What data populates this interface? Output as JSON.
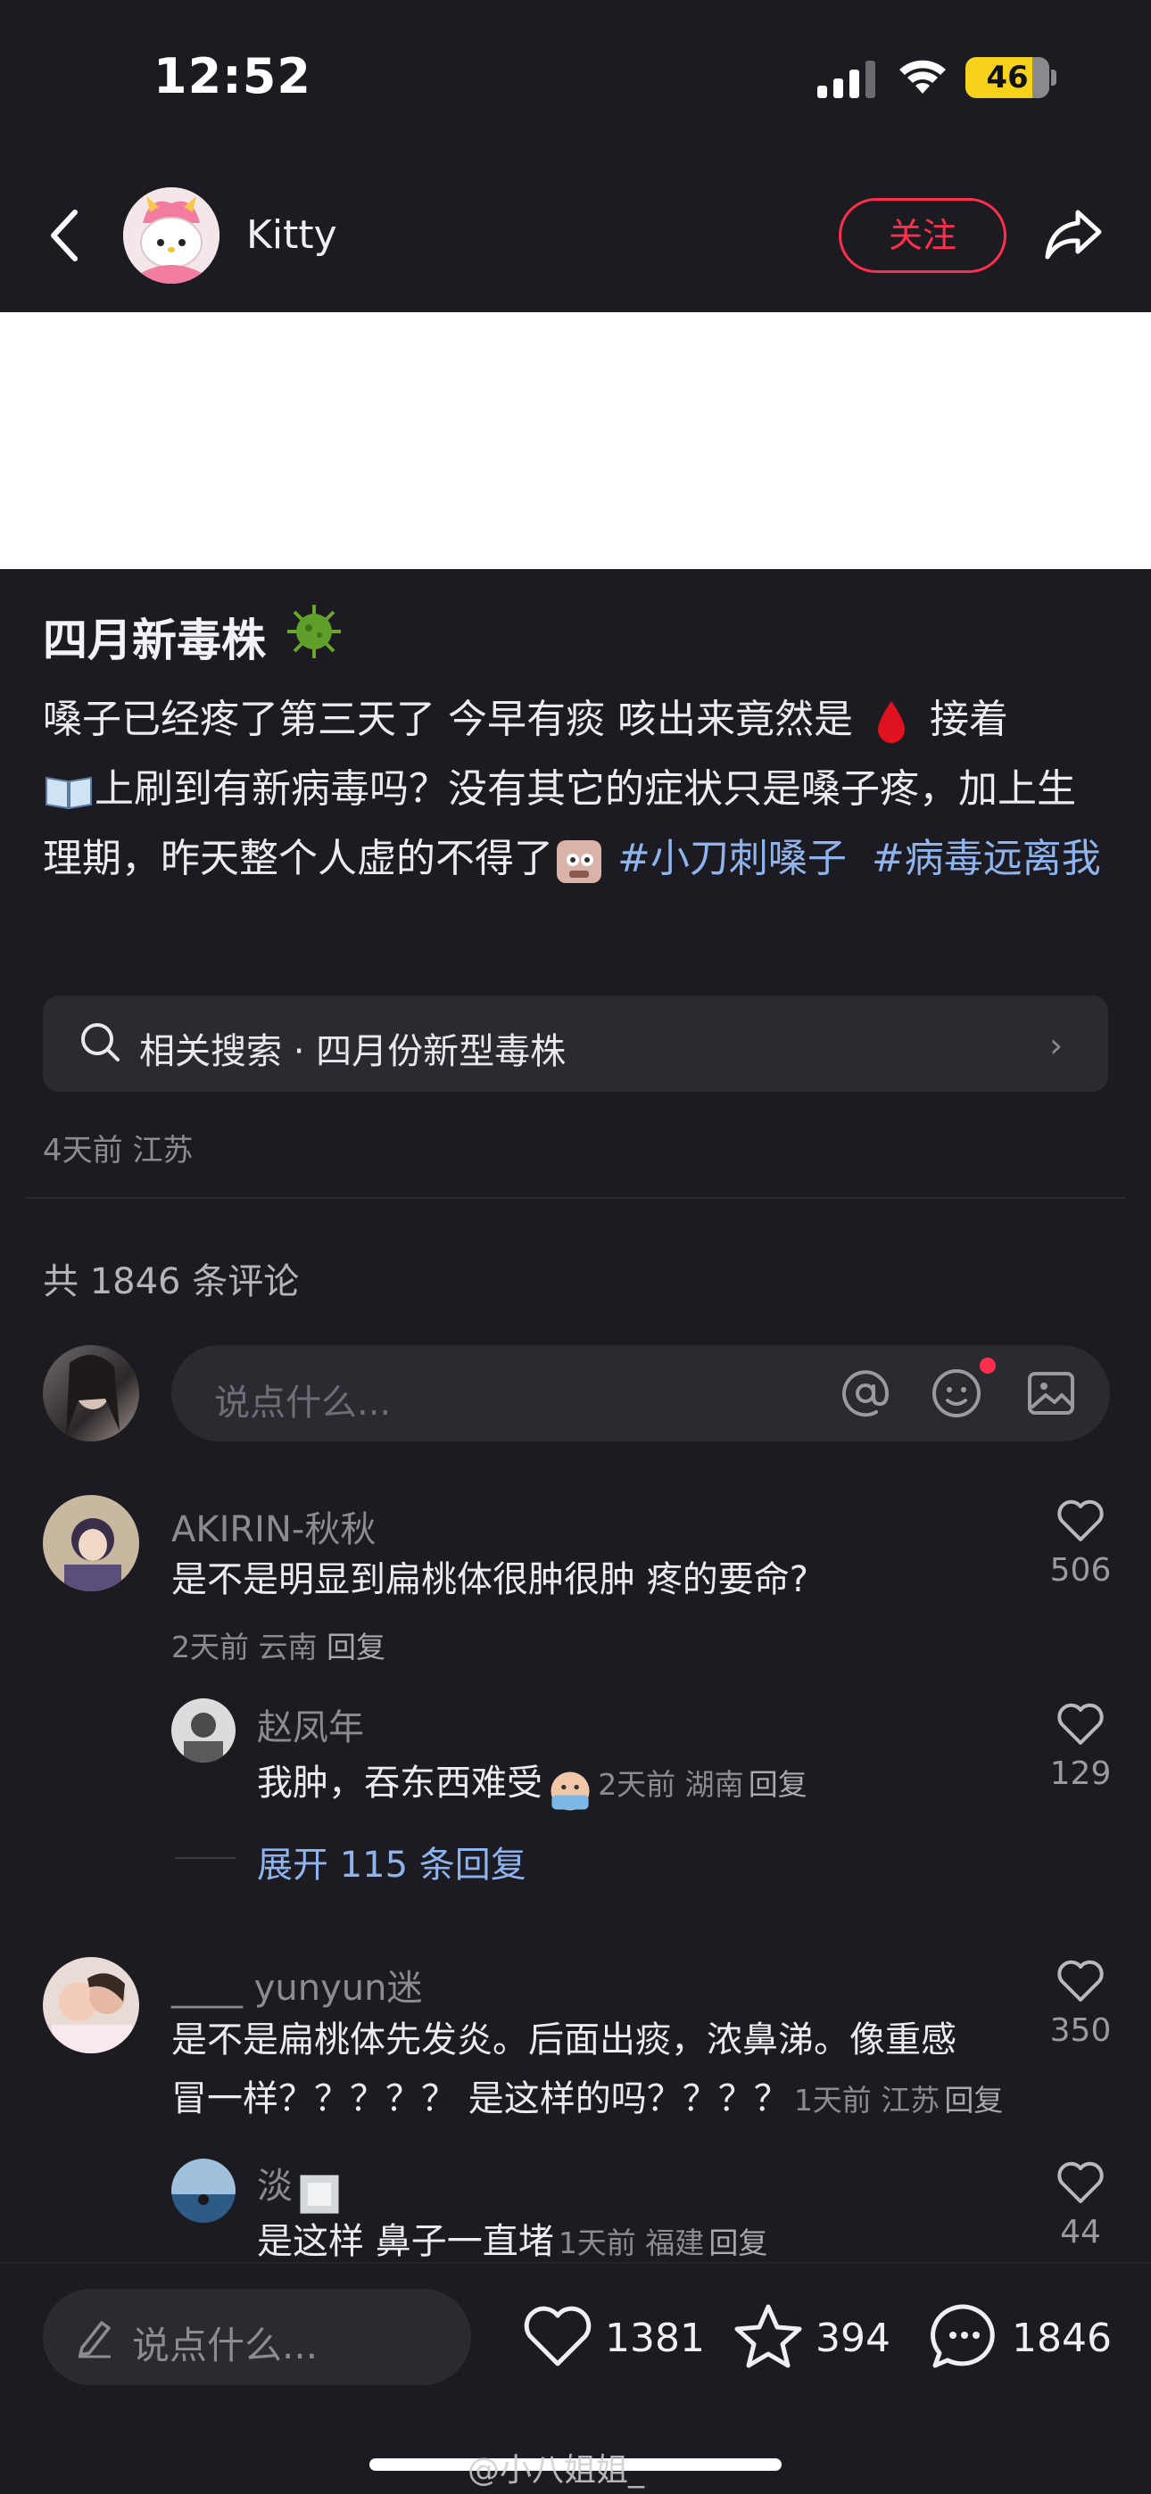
{
  "status_bar": {
    "time": "12:52",
    "battery": "46",
    "battery_level": 0.46
  },
  "header": {
    "author_name": "Kitty",
    "follow_label": "关注"
  },
  "post": {
    "title": "四月新毒株",
    "body_1": "嗓子已经疼了第三天了 今早有痰 咳出来竟然是",
    "body_2": " 接着",
    "body_3": "上刷到有新病毒吗？没有其它的症状只是嗓子疼，加上生理期，昨天整个人虚的不得了",
    "tag_1": "#小刀刺嗓子",
    "tag_2": "#病毒远离我",
    "related_search": "相关搜索 · 四月份新型毒株",
    "meta": "4天前 江苏"
  },
  "comments_section": {
    "count_label": "共 1846 条评论",
    "input_placeholder": "说点什么..."
  },
  "comments": [
    {
      "name": "AKIRIN-秋秋",
      "text": "是不是明显到扁桃体很肿很肿 疼的要命?",
      "meta": "2天前 云南",
      "reply": "回复",
      "likes": "506"
    },
    {
      "name": "赵凤年",
      "text": "我肿，吞东西难受",
      "meta": "2天前 湖南",
      "reply": "回复",
      "likes": "129"
    },
    {
      "name": "____ yunyun迷",
      "text_1": "是不是扁桃体先发炎。后面出痰，浓鼻涕。像重感",
      "text_2": "冒一样？？？？？ 是这样的吗？？？？",
      "meta": "1天前 江苏",
      "reply": "回复",
      "likes": "350"
    },
    {
      "name": "淡",
      "text": "是这样  鼻子一直堵",
      "meta": "1天前 福建",
      "reply": "回复",
      "likes": "44"
    }
  ],
  "expand_replies": "展开 115 条回复",
  "bottom_bar": {
    "input_placeholder": "说点什么...",
    "likes": "1381",
    "favorites": "394",
    "comments": "1846"
  },
  "watermark": "@小八姐姐_",
  "colors": {
    "accent": "#ff2e4d",
    "tag": "#8fb3ec",
    "background": "#1b1b21"
  }
}
